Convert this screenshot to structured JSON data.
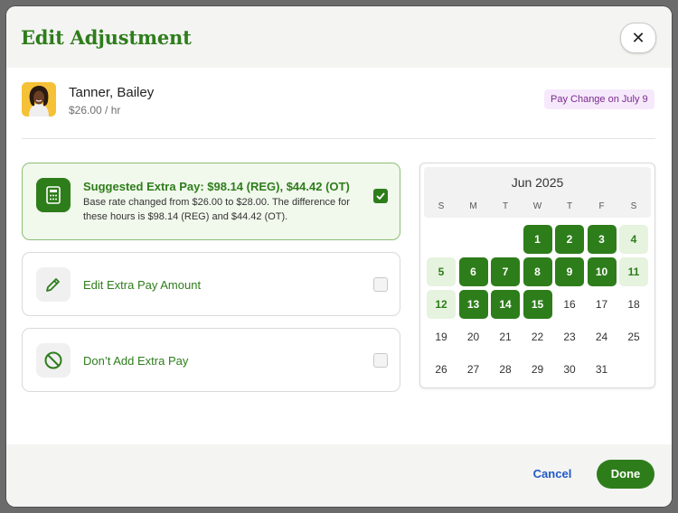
{
  "dialog": {
    "title": "Edit Adjustment",
    "close_symbol": "✕"
  },
  "employee": {
    "name": "Tanner, Bailey",
    "rate": "$26.00 / hr",
    "badge": "Pay Change on July 9"
  },
  "options": [
    {
      "title": "Suggested Extra Pay: $98.14 (REG), $44.42 (OT)",
      "description": "Base rate changed from $26.00 to $28.00. The difference for these hours is $98.14 (REG) and $44.42 (OT).",
      "icon": "calculator-icon",
      "checked": true
    },
    {
      "title": "Edit Extra Pay Amount",
      "icon": "pencil-icon",
      "checked": false
    },
    {
      "title": "Don’t Add Extra Pay",
      "icon": "prohibited-icon",
      "checked": false
    }
  ],
  "calendar": {
    "month": "Jun 2025",
    "weekdays": [
      "S",
      "M",
      "T",
      "W",
      "T",
      "F",
      "S"
    ],
    "weeks": [
      [
        {
          "d": ""
        },
        {
          "d": ""
        },
        {
          "d": ""
        },
        {
          "d": "1",
          "s": "sel"
        },
        {
          "d": "2",
          "s": "sel"
        },
        {
          "d": "3",
          "s": "sel"
        },
        {
          "d": "4",
          "s": "light"
        }
      ],
      [
        {
          "d": "5",
          "s": "light"
        },
        {
          "d": "6",
          "s": "sel"
        },
        {
          "d": "7",
          "s": "sel"
        },
        {
          "d": "8",
          "s": "sel"
        },
        {
          "d": "9",
          "s": "sel"
        },
        {
          "d": "10",
          "s": "sel"
        },
        {
          "d": "11",
          "s": "light"
        }
      ],
      [
        {
          "d": "12",
          "s": "light"
        },
        {
          "d": "13",
          "s": "sel"
        },
        {
          "d": "14",
          "s": "sel"
        },
        {
          "d": "15",
          "s": "sel"
        },
        {
          "d": "16"
        },
        {
          "d": "17"
        },
        {
          "d": "18"
        }
      ],
      [
        {
          "d": "19"
        },
        {
          "d": "20"
        },
        {
          "d": "21"
        },
        {
          "d": "22"
        },
        {
          "d": "23"
        },
        {
          "d": "24"
        },
        {
          "d": "25"
        }
      ],
      [
        {
          "d": "26"
        },
        {
          "d": "27"
        },
        {
          "d": "28"
        },
        {
          "d": "29"
        },
        {
          "d": "30"
        },
        {
          "d": "31"
        },
        {
          "d": ""
        }
      ]
    ]
  },
  "footer": {
    "cancel_label": "Cancel",
    "done_label": "Done"
  },
  "colors": {
    "brand_green": "#2e7d1b",
    "light_green": "#e6f3df",
    "badge_bg": "#f6e9fb",
    "badge_text": "#7a2a8e",
    "link_blue": "#2059c7"
  }
}
